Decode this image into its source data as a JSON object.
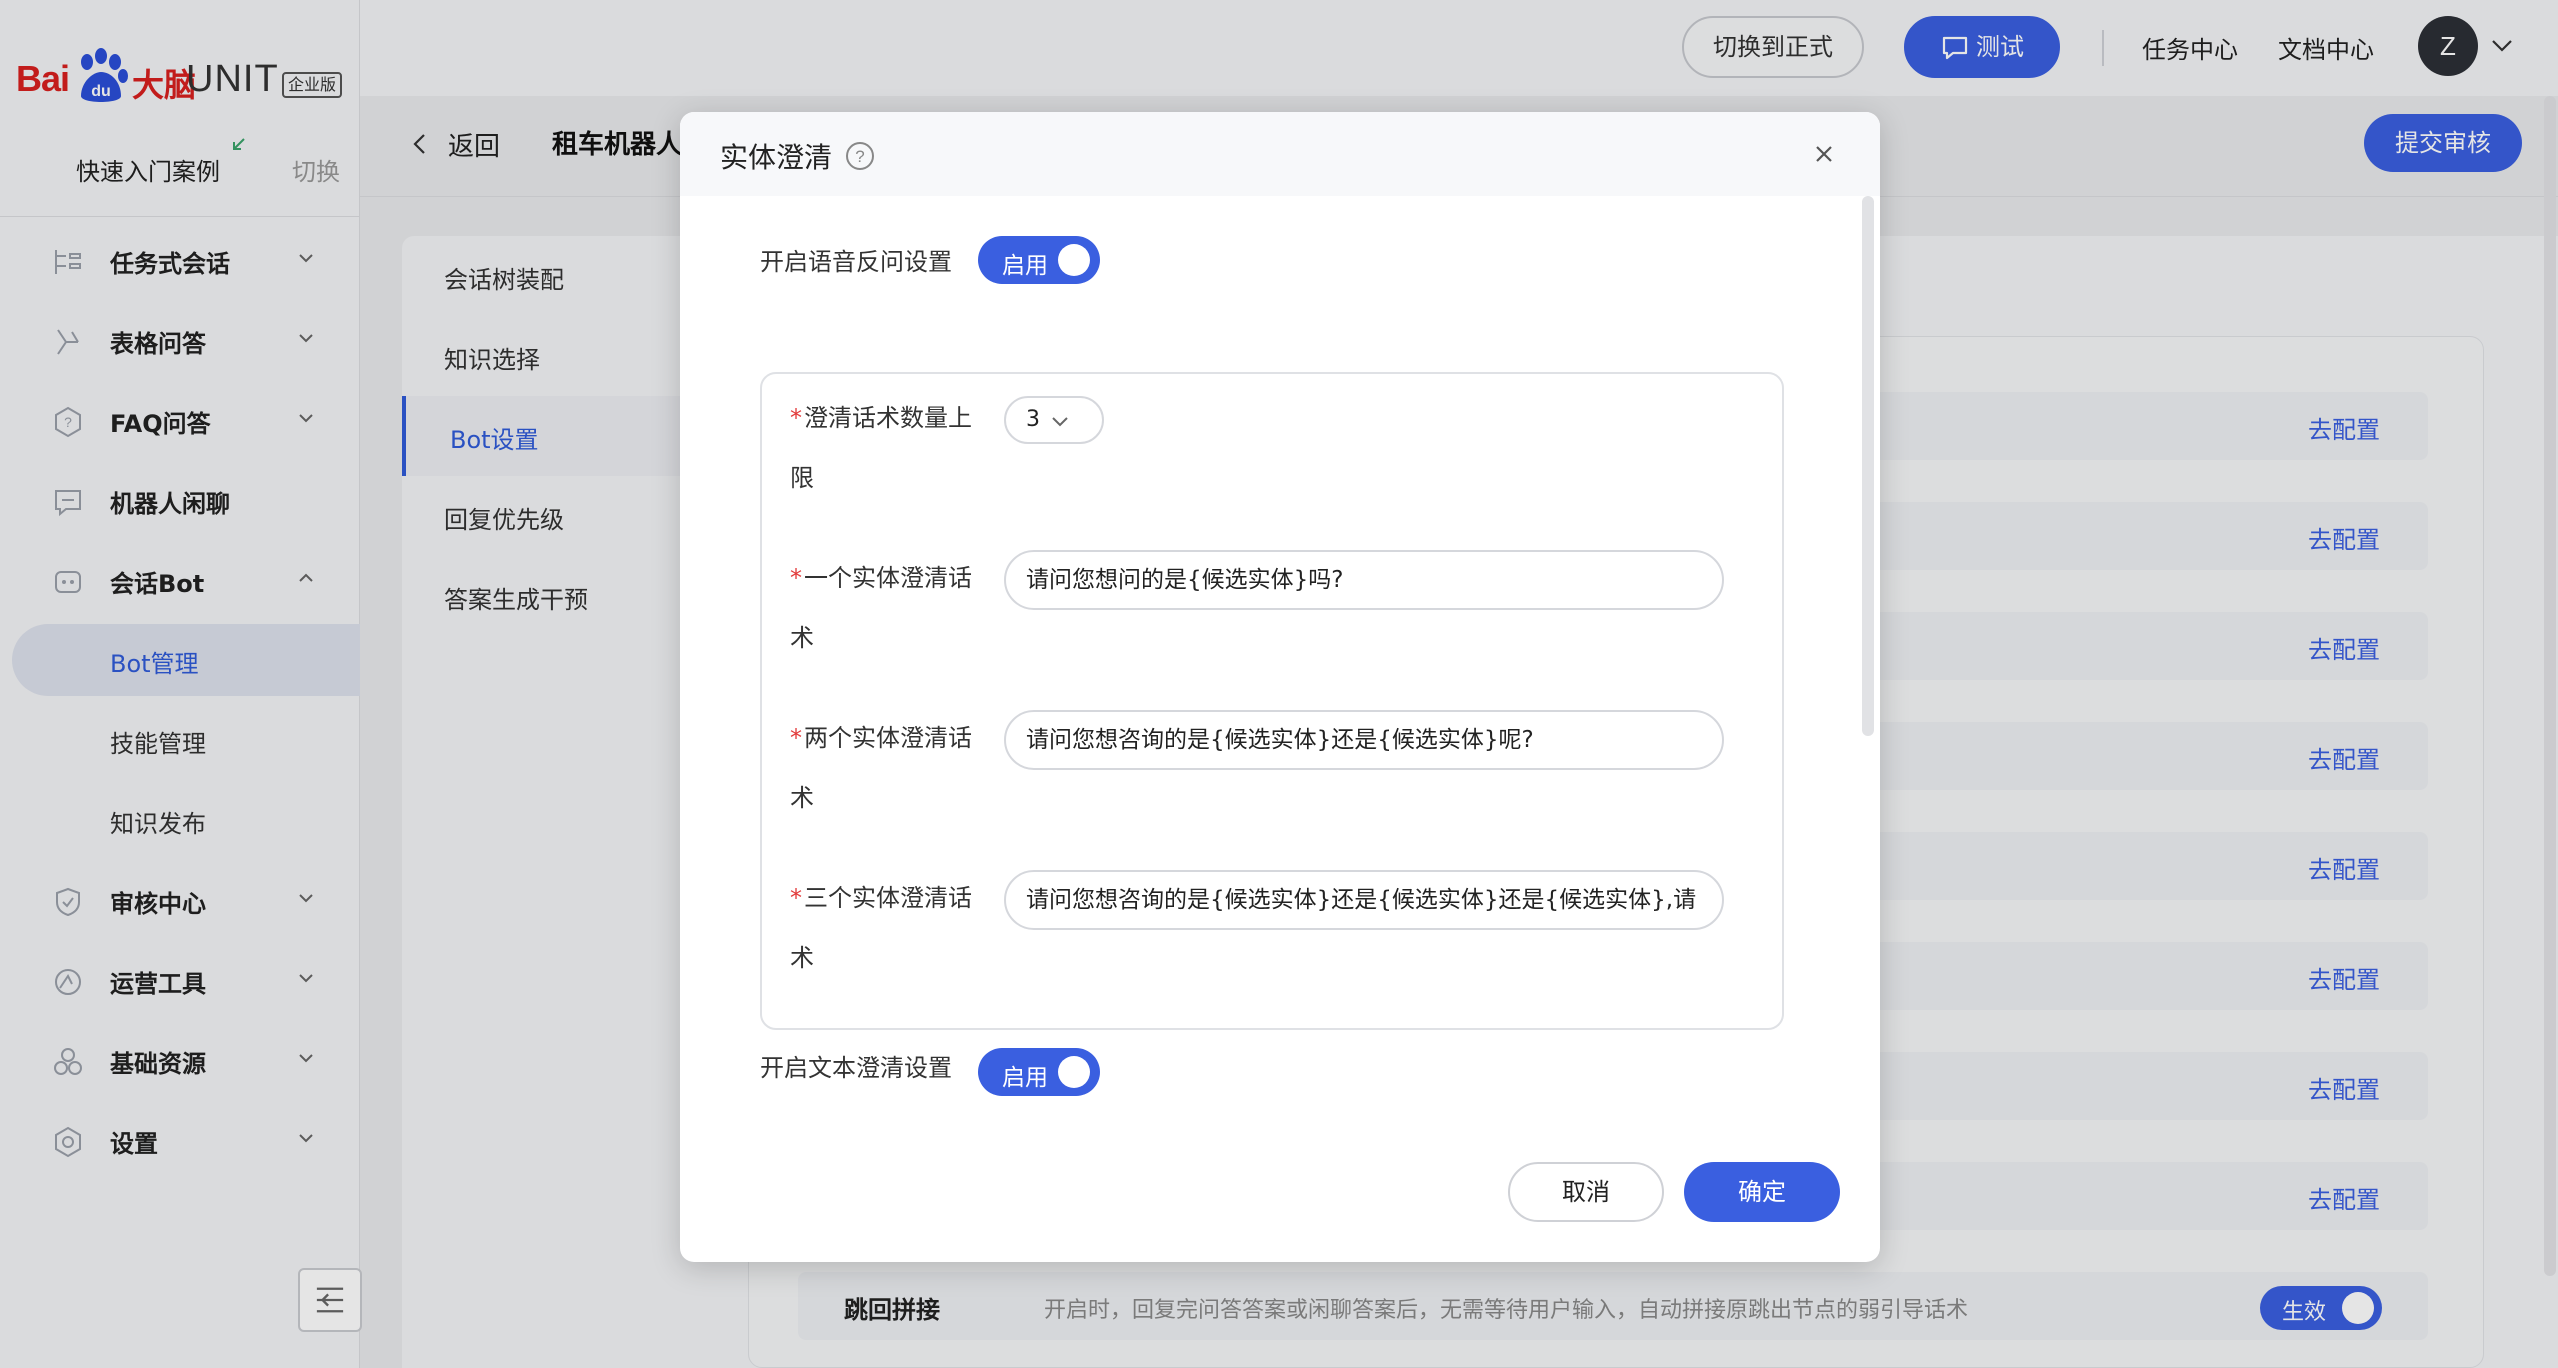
{
  "brand": {
    "bai": "Bai",
    "du": "du",
    "danao": "大脑",
    "unit": "UNIT",
    "edition": "企业版"
  },
  "sidebar": {
    "quick_start": "快速入门案例",
    "switch": "切换",
    "items": [
      {
        "label": "任务式会话",
        "icon": "task-flow-icon"
      },
      {
        "label": "表格问答",
        "icon": "table-qa-icon"
      },
      {
        "label": "FAQ问答",
        "icon": "faq-icon"
      },
      {
        "label": "机器人闲聊",
        "icon": "chat-icon"
      },
      {
        "label": "会话Bot",
        "icon": "bot-icon"
      },
      {
        "label": "审核中心",
        "icon": "shield-icon"
      },
      {
        "label": "运营工具",
        "icon": "operations-icon"
      },
      {
        "label": "基础资源",
        "icon": "resources-icon"
      },
      {
        "label": "设置",
        "icon": "gear-icon"
      }
    ],
    "bot_sub": [
      "Bot管理",
      "技能管理",
      "知识发布"
    ]
  },
  "topbar": {
    "switch_prod": "切换到正式",
    "test": "测试",
    "task_center": "任务中心",
    "doc_center": "文档中心",
    "avatar_letter": "Z"
  },
  "page": {
    "back": "返回",
    "bot_name": "租车机器人",
    "submit": "提交审核"
  },
  "settings_menu": [
    "会话树装配",
    "知识选择",
    "Bot设置",
    "回复优先级",
    "答案生成干预"
  ],
  "config_link": "去配置",
  "jump": {
    "label": "跳回拼接",
    "desc": "开启时，回复完问答答案或闲聊答案后，无需等待用户输入，自动拼接原跳出节点的弱引导话术",
    "toggle": "生效"
  },
  "modal": {
    "title": "实体澄清",
    "voice_label": "开启语音反问设置",
    "voice_toggle": "启用",
    "count_label": "澄清话术数量上限",
    "count_value": "3",
    "one_label": "一个实体澄清话术",
    "one_value": "请问您想问的是{候选实体}吗?",
    "two_label": "两个实体澄清话术",
    "two_value": "请问您想咨询的是{候选实体}还是{候选实体}呢?",
    "three_label": "三个实体澄清话术",
    "three_value": "请问您想咨询的是{候选实体}还是{候选实体}还是{候选实体},请",
    "text_label": "开启文本澄清设置",
    "text_toggle": "启用",
    "cancel": "取消",
    "ok": "确定"
  },
  "colors": {
    "primary": "#3a5fe0",
    "required": "#e23b3b"
  }
}
